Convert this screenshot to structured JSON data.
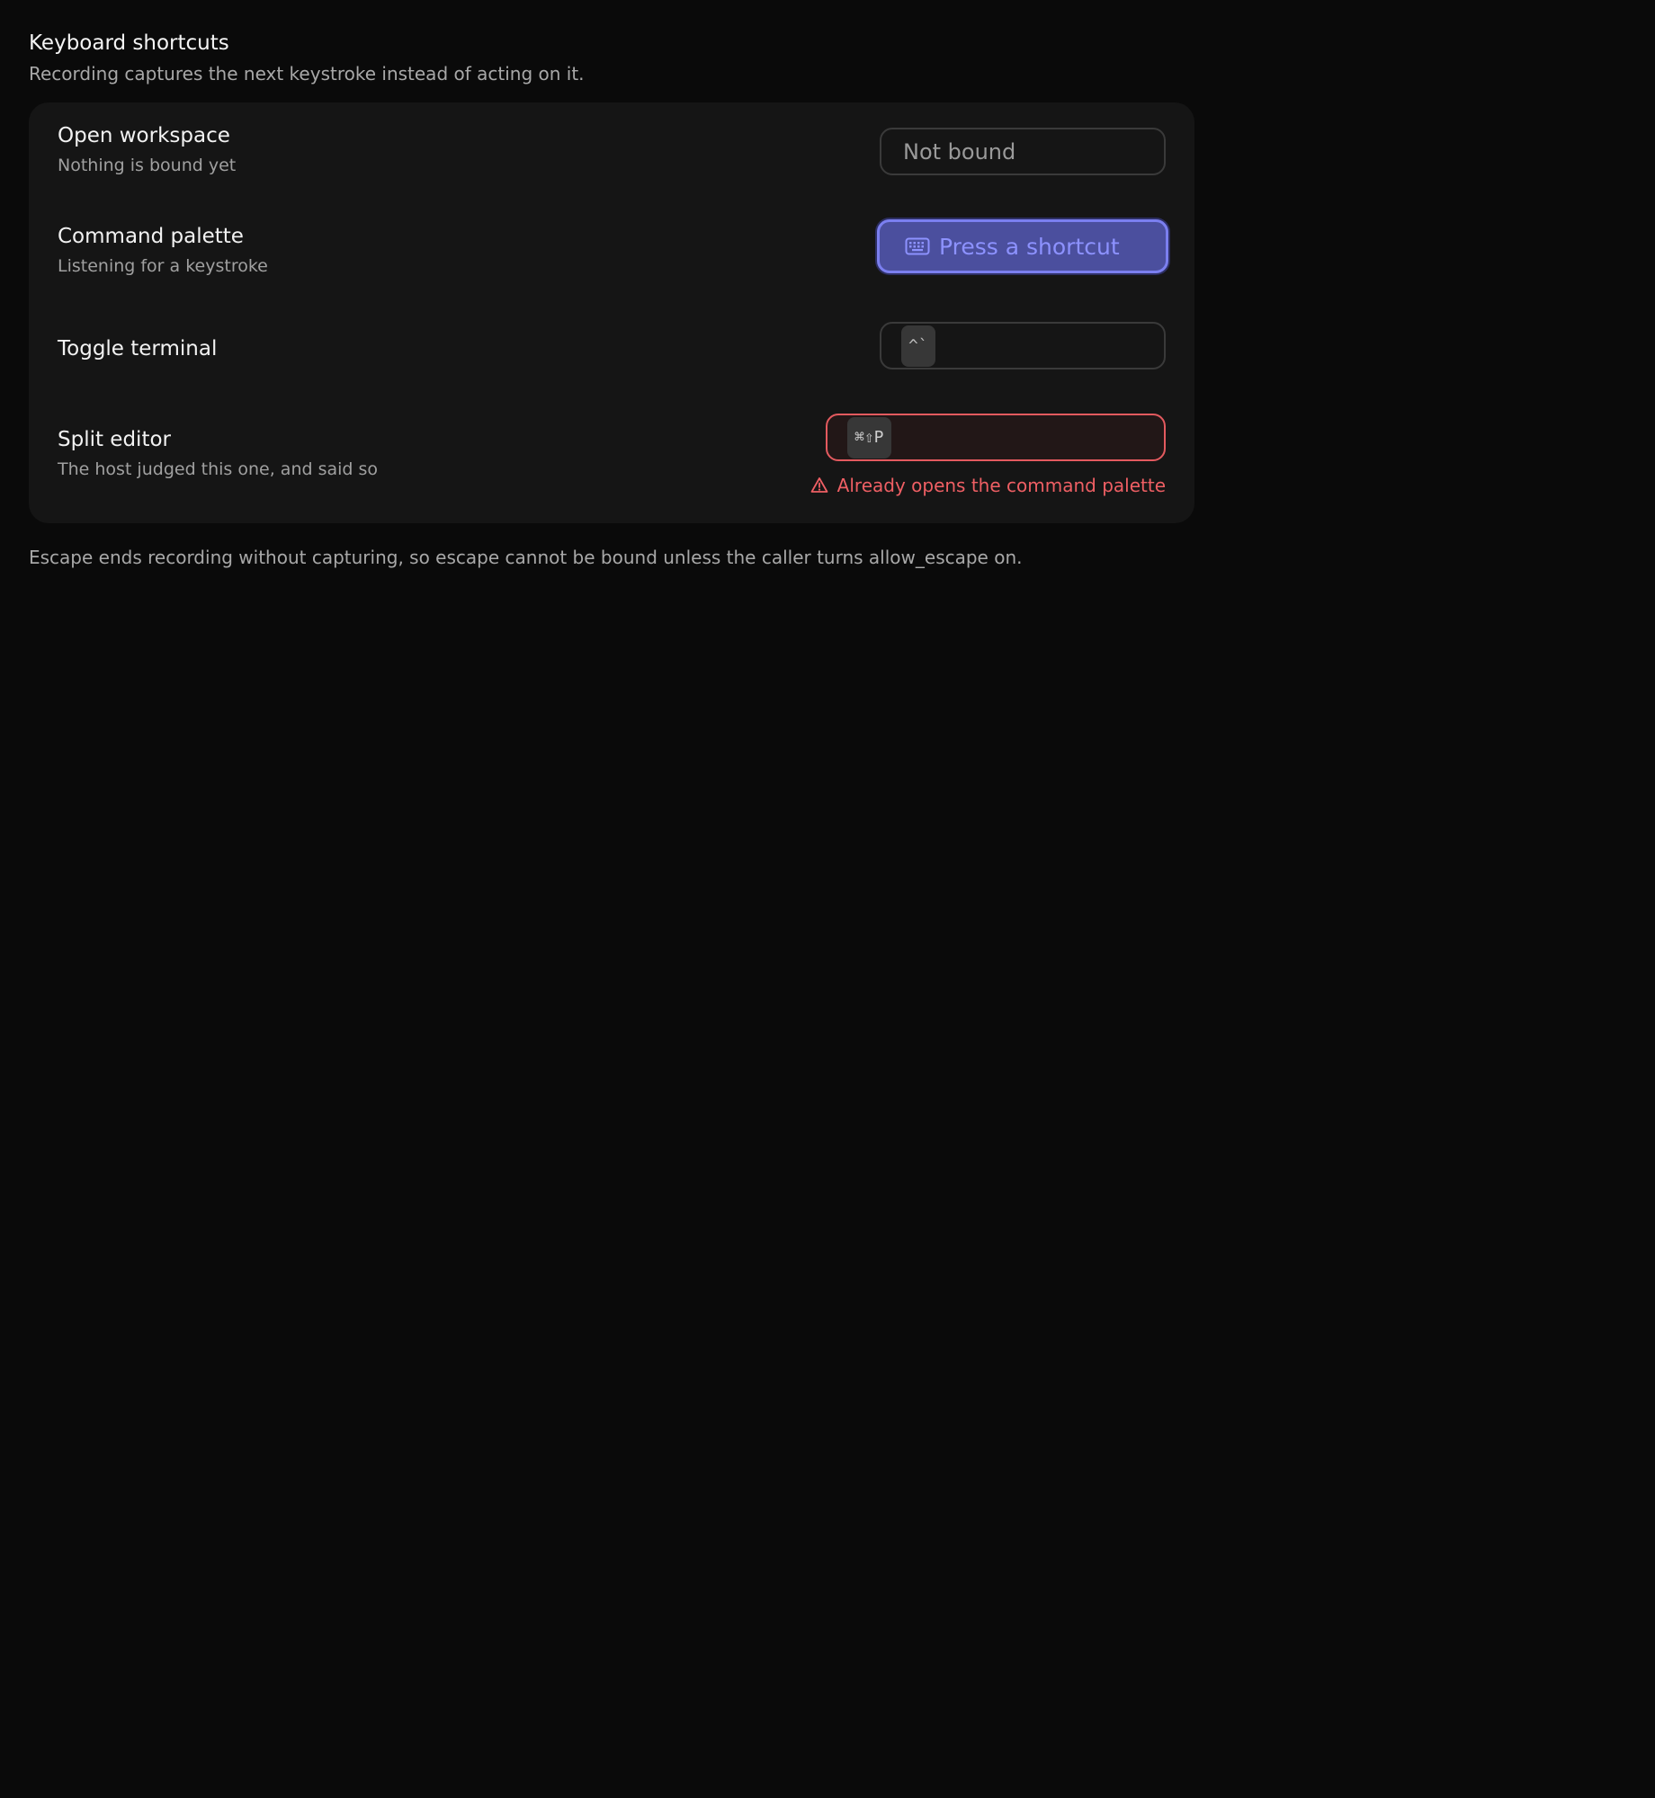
{
  "header": {
    "title": "Keyboard shortcuts",
    "subtitle": "Recording captures the next keystroke instead of acting on it."
  },
  "shortcuts": [
    {
      "title": "Open workspace",
      "description": "Nothing is bound yet",
      "state": "unbound",
      "field_text": "Not bound"
    },
    {
      "title": "Command palette",
      "description": "Listening for a keystroke",
      "state": "recording",
      "field_text": "Press a shortcut",
      "icon": "keyboard-icon"
    },
    {
      "title": "Toggle terminal",
      "description": "",
      "state": "bound",
      "keys": "^`"
    },
    {
      "title": "Split editor",
      "description": "The host judged this one, and said so",
      "state": "error",
      "keys": "⌘⇧P",
      "error": "Already opens the command palette",
      "icon": "warning-triangle-icon"
    }
  ],
  "footnote": "Escape ends recording without capturing, so escape cannot be bound unless the caller turns allow_escape on.",
  "colors": {
    "background": "#0a0a0a",
    "panel": "#151515",
    "accent": "#7b7ff0",
    "error": "#ef5f64"
  }
}
